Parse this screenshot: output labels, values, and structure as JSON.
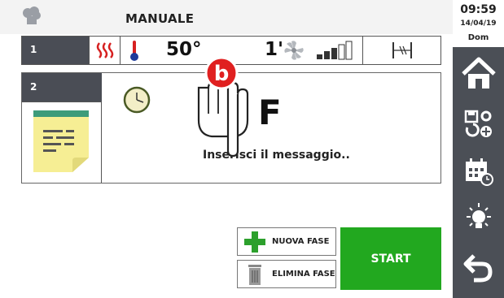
{
  "header": {
    "title": "MANUALE"
  },
  "clock": {
    "time": "09:59",
    "date": "14/04/19",
    "day": "Dom"
  },
  "phase1": {
    "number": "1",
    "temperature": "50°",
    "time": "1'"
  },
  "phase2": {
    "number": "2",
    "big_letter": "F",
    "message": "Inserisci il messaggio.."
  },
  "buttons": {
    "new_phase": "NUOVA FASE",
    "delete_phase": "ELIMINA FASE",
    "start": "START"
  },
  "badge": {
    "letter": "b"
  },
  "colors": {
    "sidebar": "#4b4f56",
    "phase_header": "#4a4d55",
    "start": "#22a81f",
    "heat": "#d62020",
    "badge": "#e02020"
  },
  "icons": [
    "chef-hat-icon",
    "heating-icon",
    "thermometer-icon",
    "fan-icon",
    "fan-speed-icon",
    "vent-icon",
    "clock-icon",
    "note-icon",
    "plus-icon",
    "trash-icon",
    "home-icon",
    "save-settings-icon",
    "calendar-icon",
    "light-icon",
    "back-icon",
    "pointer-hand-icon"
  ]
}
